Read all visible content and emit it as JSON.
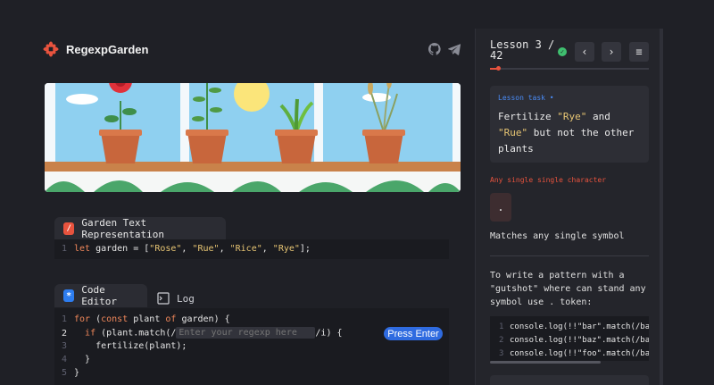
{
  "app": {
    "name": "RegexpGarden"
  },
  "header_icons": [
    "github-icon",
    "telegram-icon"
  ],
  "garden_panel": {
    "tab_label": "Garden Text Representation",
    "code": {
      "kw": "let",
      "pre": " garden = [",
      "items": [
        "\"Rose\"",
        "\"Rue\"",
        "\"Rice\"",
        "\"Rye\""
      ],
      "post": "];"
    }
  },
  "editor_panel": {
    "tabs": {
      "editor": "Code Editor",
      "log": "Log"
    },
    "lines": {
      "l1": {
        "kw1": "for",
        "a": " (",
        "kw2": "const",
        "b": " plant ",
        "kw3": "of",
        "c": " garden) {"
      },
      "l2": {
        "kw": "if",
        "a": " (plant.match(/",
        "b": "/i) {"
      },
      "l3": "fertilize(plant);",
      "l4": "}",
      "l5": "}"
    },
    "regex_placeholder": "Enter your regexp here",
    "press_enter": "Press Enter"
  },
  "lesson": {
    "title": "Lesson 3 / 42",
    "progress_fraction": 0.05,
    "task_label": "Lesson task •",
    "task": {
      "t1": "Fertilize ",
      "h1": "\"Rye\"",
      "t2": " and ",
      "h2": "\"Rue\"",
      "t3": " but not the other plants"
    },
    "hint_title": "Any single single character",
    "symbol": ".",
    "matches_text": "Matches any single symbol",
    "paragraph": "To write a pattern with a \"gutshot\" where can stand any symbol use . token:",
    "examples": [
      "console.log(!!\"bar\".match(/ba",
      "console.log(!!\"baz\".match(/ba",
      "console.log(!!\"foo\".match(/ba"
    ]
  },
  "colors": {
    "accent": "#e8533e",
    "blue": "#2f6be0",
    "string": "#e7c573",
    "keyword": "#f0875a"
  }
}
